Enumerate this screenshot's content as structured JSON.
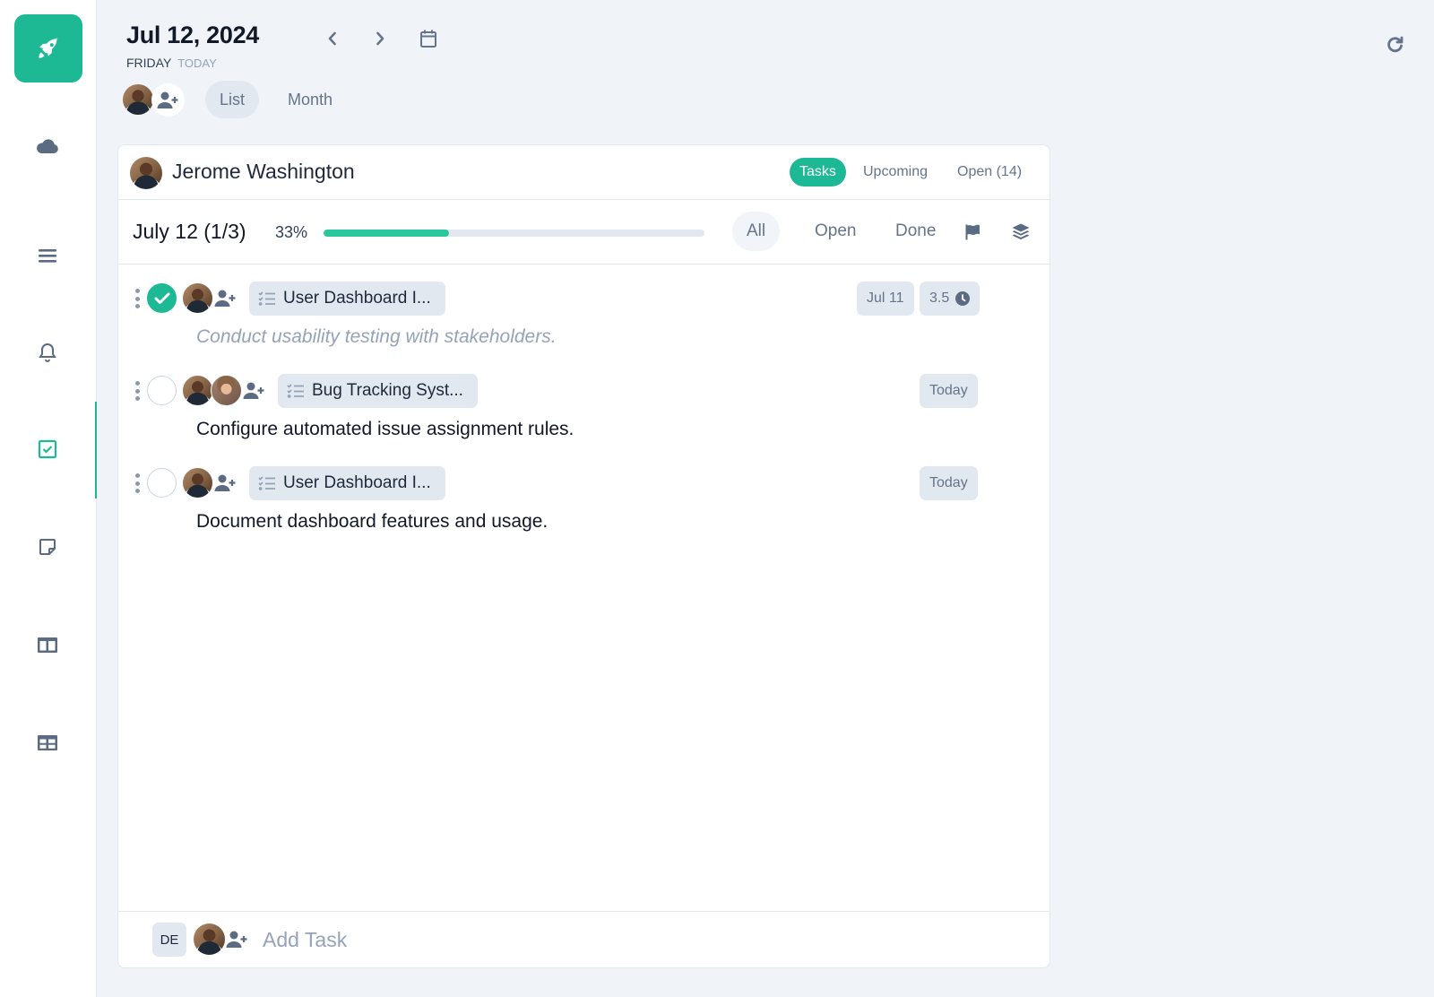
{
  "app": {
    "brand_color": "#1cb994",
    "logo_icon": "rocket-icon"
  },
  "sidebar": {
    "items": [
      {
        "name": "cloud",
        "icon": "cloud-icon",
        "active": false
      },
      {
        "name": "list",
        "icon": "menu-lines-icon",
        "active": false
      },
      {
        "name": "notifications",
        "icon": "bell-icon",
        "active": false
      },
      {
        "name": "tasks",
        "icon": "checkbox-icon",
        "active": true
      },
      {
        "name": "notes",
        "icon": "sticky-note-icon",
        "active": false
      },
      {
        "name": "columns",
        "icon": "columns-icon",
        "active": false
      },
      {
        "name": "table",
        "icon": "table-icon",
        "active": false
      }
    ]
  },
  "header": {
    "date": "Jul 12, 2024",
    "weekday": "FRIDAY",
    "today_label": "TODAY",
    "prev_icon": "chevron-left-icon",
    "next_icon": "chevron-right-icon",
    "calendar_icon": "calendar-icon",
    "refresh_icon": "refresh-icon",
    "view_tabs": [
      {
        "label": "List",
        "active": true
      },
      {
        "label": "Month",
        "active": false
      }
    ]
  },
  "card": {
    "user_name": "Jerome Washington",
    "tabs": [
      {
        "label": "Tasks",
        "active": true
      },
      {
        "label": "Upcoming",
        "active": false
      },
      {
        "label": "Open (14)",
        "active": false
      }
    ],
    "day": {
      "label": "July 12 (1/3)",
      "progress_label": "33%",
      "progress_fraction": 0.33,
      "filters": [
        {
          "label": "All",
          "active": true
        },
        {
          "label": "Open",
          "active": false
        },
        {
          "label": "Done",
          "active": false
        }
      ],
      "flag_icon": "flag-icon",
      "layers_icon": "layers-icon"
    },
    "tasks": [
      {
        "done": true,
        "assignees": [
          "male"
        ],
        "project": "User Dashboard I...",
        "text": "Conduct usability testing with stakeholders.",
        "date_badge": "Jul 11",
        "estimate": "3.5"
      },
      {
        "done": false,
        "assignees": [
          "male",
          "female"
        ],
        "project": "Bug Tracking Syst...",
        "text": "Configure automated issue assignment rules.",
        "date_badge": "Today",
        "estimate": null
      },
      {
        "done": false,
        "assignees": [
          "male"
        ],
        "project": "User Dashboard I...",
        "text": "Document dashboard features and usage.",
        "date_badge": "Today",
        "estimate": null
      }
    ],
    "footer": {
      "initials": "DE",
      "add_task_placeholder": "Add Task",
      "add_task_value": ""
    }
  }
}
